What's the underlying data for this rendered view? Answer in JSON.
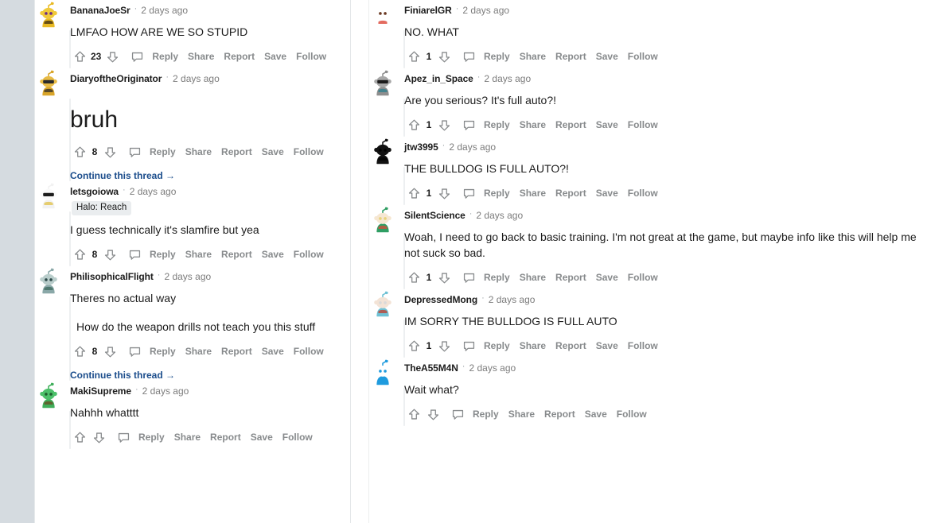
{
  "layout": {
    "columns": 2,
    "gutter_color": "#d5dbe0",
    "background": "#ffffff",
    "link_color": "#1a4c8b",
    "action_color": "#878a8c",
    "text_color": "#1c1c1c"
  },
  "actions": {
    "reply": "Reply",
    "share": "Share",
    "report": "Report",
    "save": "Save",
    "follow": "Follow",
    "continue_thread": "Continue this thread",
    "continue_arrow": "→",
    "separator": "·"
  },
  "icons": {
    "upvote": "upvote-arrow-icon",
    "downvote": "downvote-arrow-icon",
    "comment": "comment-bubble-icon"
  },
  "left_column": {
    "comments": [
      {
        "author": "BananaJoeSr",
        "age": "2 days ago",
        "flair": null,
        "paragraphs": [
          "LMFAO HOW ARE WE SO STUPID"
        ],
        "score": "23",
        "big": false,
        "continue_thread": false,
        "avatar": "snoo-yellow",
        "indent_body": false
      },
      {
        "author": "DiaryoftheOriginator",
        "age": "2 days ago",
        "flair": null,
        "paragraphs": [
          "bruh"
        ],
        "score": "8",
        "big": true,
        "continue_thread": true,
        "avatar": "snoo-gold-sunglasses",
        "indent_body": false
      },
      {
        "author": "letsgoiowa",
        "age": "2 days ago",
        "flair": "Halo: Reach",
        "paragraphs": [
          "I guess technically it's slamfire but yea"
        ],
        "score": "8",
        "big": false,
        "continue_thread": false,
        "avatar": "snoo-white-sunglasses",
        "indent_body": false
      },
      {
        "author": "PhilisophicalFlight",
        "age": "2 days ago",
        "flair": null,
        "paragraphs": [
          "Theres no actual way",
          "How do the weapon drills not teach you this stuff"
        ],
        "score": "8",
        "big": false,
        "continue_thread": true,
        "avatar": "snoo-teal",
        "indent_body": false
      },
      {
        "author": "MakiSupreme",
        "age": "2 days ago",
        "flair": null,
        "paragraphs": [
          "Nahhh whatttt"
        ],
        "score": null,
        "big": false,
        "continue_thread": false,
        "avatar": "snoo-green",
        "indent_body": false
      }
    ]
  },
  "right_column": {
    "comments": [
      {
        "author": "FiniarelGR",
        "age": "2 days ago",
        "flair": null,
        "paragraphs": [
          "NO. WHAT"
        ],
        "score": "1",
        "big": false,
        "continue_thread": false,
        "avatar": "snoo-red-brown",
        "indent_body": false
      },
      {
        "author": "Apez_in_Space",
        "age": "2 days ago",
        "flair": null,
        "paragraphs": [
          "Are you serious? It's full auto?!"
        ],
        "score": "1",
        "big": false,
        "continue_thread": false,
        "avatar": "snoo-gray-sunglasses",
        "indent_body": false
      },
      {
        "author": "jtw3995",
        "age": "2 days ago",
        "flair": null,
        "paragraphs": [
          "THE BULLDOG IS FULL AUTO?!"
        ],
        "score": "1",
        "big": false,
        "continue_thread": false,
        "avatar": "snoo-black",
        "indent_body": false
      },
      {
        "author": "SilentScience",
        "age": "2 days ago",
        "flair": null,
        "paragraphs": [
          "Woah, I need to go back to basic training. I'm not great at the game, but maybe info like this will help me not suck so bad."
        ],
        "score": "1",
        "big": false,
        "continue_thread": false,
        "avatar": "snoo-blonde-green",
        "indent_body": false,
        "wrap": true
      },
      {
        "author": "DepressedMong",
        "age": "2 days ago",
        "flair": null,
        "paragraphs": [
          "IM SORRY THE BULLDOG IS FULL AUTO"
        ],
        "score": "1",
        "big": false,
        "continue_thread": false,
        "avatar": "snoo-pale-blue",
        "indent_body": false
      },
      {
        "author": "TheA55M4N",
        "age": "2 days ago",
        "flair": null,
        "paragraphs": [
          "Wait what?"
        ],
        "score": null,
        "big": false,
        "continue_thread": false,
        "avatar": "snoo-bright-blue",
        "indent_body": false
      }
    ]
  }
}
